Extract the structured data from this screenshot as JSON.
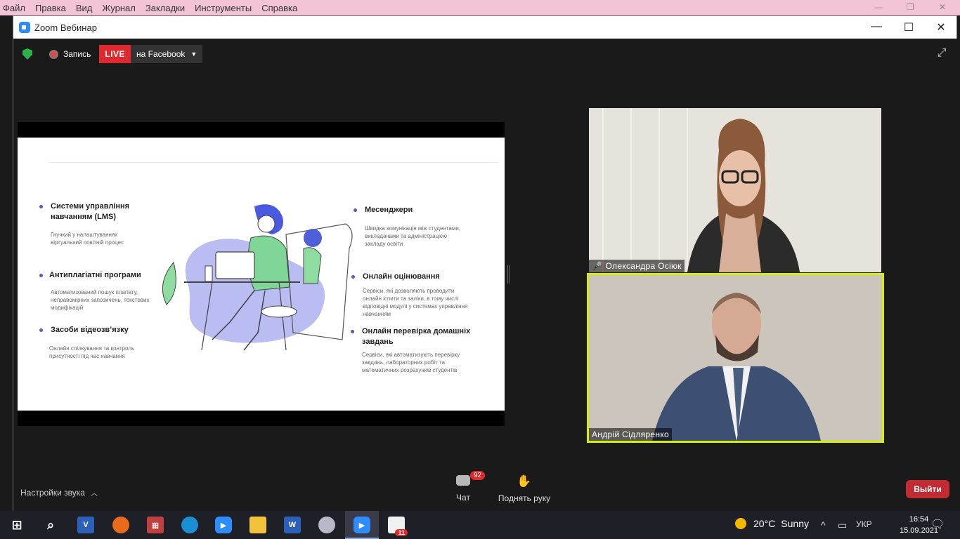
{
  "browser_menu": {
    "items": [
      "Файл",
      "Правка",
      "Вид",
      "Журнал",
      "Закладки",
      "Инструменты",
      "Справка"
    ]
  },
  "window": {
    "title": "Zoom Вебинар",
    "icons": [
      "minimize-icon",
      "maximize-icon",
      "close-icon"
    ]
  },
  "toolbar": {
    "record_label": "Запись",
    "live_label": "LIVE",
    "stream_target": "на Facebook"
  },
  "slide": {
    "left_items": [
      {
        "title": "Системи управління навчанням (LMS)",
        "desc": "Гнучкий у налаштуваннях віртуальний освітній процес"
      },
      {
        "title": "Антиплагіатні програми",
        "desc": "Автоматизований пошук плагіату, неправомірних запозичень, текстових модифікацій"
      },
      {
        "title": "Засоби відеозв’язку",
        "desc": "Онлайн спілкування та контроль присутності під час навчання"
      }
    ],
    "right_items": [
      {
        "title": "Месенджери",
        "desc": "Швидка комунікація між студентами, викладачами та адміністрацією закладу освіти"
      },
      {
        "title": "Онлайн оцінювання",
        "desc": "Сервіси, які дозволяють проводити онлайн іспити та заліки, в тому числі відповідні модулі у системах управління навчанням"
      },
      {
        "title": "Онлайн перевірка домашніх завдань",
        "desc": "Сервіси, які автоматизують перевірку завдань, лабораторних робіт та математичних розрахунків студентів"
      }
    ]
  },
  "participants": [
    {
      "name": "Олександра Осіюк",
      "muted": true
    },
    {
      "name": "Андрій Сідляренко",
      "active_speaker": true,
      "highlight_color": "#d4f000"
    }
  ],
  "bottom_bar": {
    "audio_settings": "Настройки звука",
    "chat_label": "Чат",
    "chat_badge": "92",
    "raise_hand_label": "Поднять руку",
    "leave_label": "Выйти"
  },
  "taskbar": {
    "weather_temp": "20°C",
    "weather_text": "Sunny",
    "language": "УКР",
    "time": "16:54",
    "date": "15.09.2021",
    "notification_badge": "11"
  },
  "colors": {
    "live_red": "#e0282f",
    "leave_red": "#c12b31",
    "speaker_highlight": "#d4f000",
    "shield_green": "#2bb34a"
  }
}
